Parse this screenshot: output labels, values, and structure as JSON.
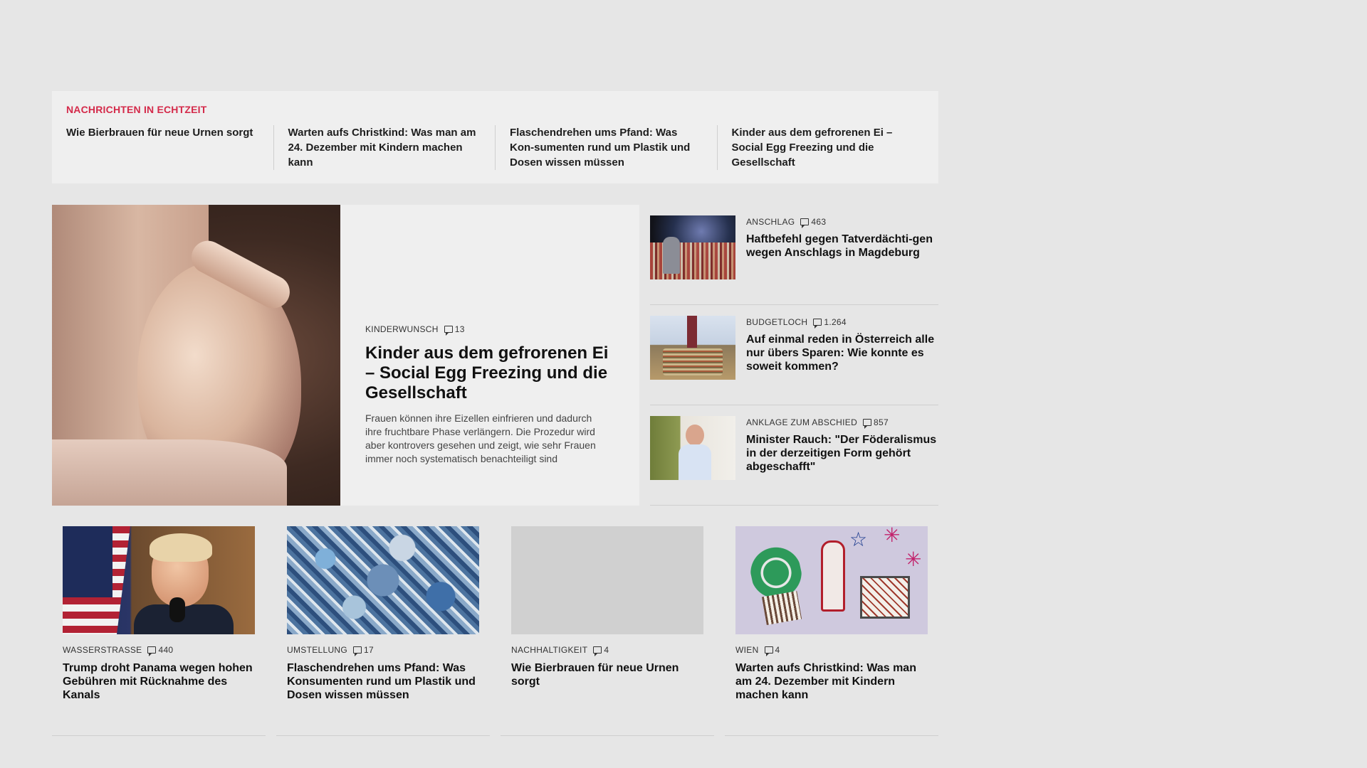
{
  "ticker": {
    "title": "NACHRICHTEN IN ECHTZEIT",
    "items": [
      "Wie Bierbrauen für neue Urnen sorgt",
      "Warten aufs Christkind: Was man am 24. Dezember mit Kindern machen kann",
      "Flaschendrehen ums Pfand: Was Kon-sumenten rund um Plastik und Dosen wissen müssen",
      "Kinder aus dem gefrorenen Ei – Social Egg Freezing und die Gesellschaft"
    ]
  },
  "hero": {
    "kicker": "KINDERWUNSCH",
    "comments": "13",
    "title": "Kinder aus dem gefrorenen Ei – Social Egg Freezing und die Gesellschaft",
    "teaser": "Frauen können ihre Eizellen einfrieren und dadurch ihre fruchtbare Phase verlängern. Die Prozedur wird aber kontrovers gesehen und zeigt, wie sehr Frauen immer noch systematisch benachteiligt sind"
  },
  "side": [
    {
      "kicker": "ANSCHLAG",
      "comments": "463",
      "title": "Haftbefehl gegen Tatverdächti-gen wegen Anschlags in Magdeburg"
    },
    {
      "kicker": "BUDGETLOCH",
      "comments": "1.264",
      "title": "Auf einmal reden in Österreich alle nur übers Sparen: Wie konnte es soweit kommen?"
    },
    {
      "kicker": "ANKLAGE ZUM ABSCHIED",
      "comments": "857",
      "title": "Minister Rauch: \"Der Föderalismus in der derzeitigen Form gehört abgeschafft\""
    }
  ],
  "cards": [
    {
      "kicker": "WASSERSTRASSE",
      "comments": "440",
      "title": "Trump droht Panama wegen hohen Gebühren mit Rücknahme des Kanals"
    },
    {
      "kicker": "UMSTELLUNG",
      "comments": "17",
      "title": "Flaschendrehen ums Pfand: Was Konsumenten rund um Plastik und Dosen wissen müssen"
    },
    {
      "kicker": "NACHHALTIGKEIT",
      "comments": "4",
      "title": "Wie Bierbrauen für neue Urnen sorgt"
    },
    {
      "kicker": "WIEN",
      "comments": "4",
      "title": "Warten aufs Christkind: Was man am 24. Dezember mit Kindern machen kann"
    }
  ],
  "colors": {
    "accent": "#d42a4a",
    "background": "#e6e6e6",
    "panel": "#efefef"
  },
  "icons": {
    "comments": "speech-bubble"
  }
}
